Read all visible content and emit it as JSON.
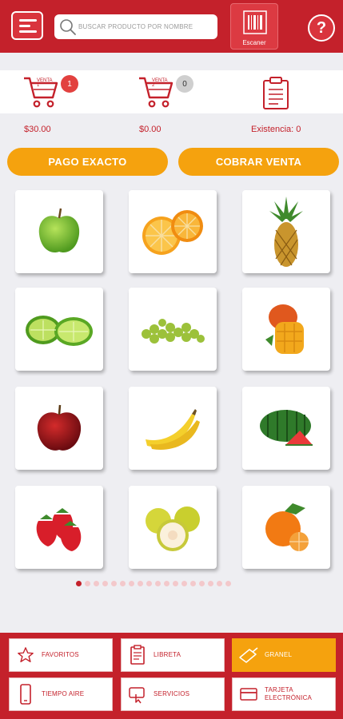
{
  "header": {
    "search_placeholder": "BUSCAR PRODUCTO POR NOMBRE",
    "scanner_label": "Escaner",
    "help_label": "?"
  },
  "sales": [
    {
      "label": "VENTA 1",
      "badge": "1",
      "amount": "$30.00"
    },
    {
      "label": "VENTA 2",
      "badge": "0",
      "amount": "$0.00"
    }
  ],
  "stock": {
    "label": "Existencia: 0"
  },
  "actions": {
    "exact_payment": "PAGO EXACTO",
    "charge_sale": "COBRAR VENTA"
  },
  "products": [
    {
      "name": "green-apple"
    },
    {
      "name": "orange"
    },
    {
      "name": "pineapple"
    },
    {
      "name": "lime"
    },
    {
      "name": "grapes"
    },
    {
      "name": "mango"
    },
    {
      "name": "red-apple"
    },
    {
      "name": "banana"
    },
    {
      "name": "watermelon"
    },
    {
      "name": "strawberry"
    },
    {
      "name": "guava"
    },
    {
      "name": "mandarin"
    }
  ],
  "pagination": {
    "total": 18,
    "current": 1
  },
  "bottom_nav": [
    {
      "label": "FAVORITOS",
      "icon": "star-icon"
    },
    {
      "label": "LIBRETA",
      "icon": "notebook-icon"
    },
    {
      "label": "GRANEL",
      "icon": "scoop-icon",
      "active": true
    },
    {
      "label": "TIEMPO AIRE",
      "icon": "phone-icon"
    },
    {
      "label": "SERVICIOS",
      "icon": "services-icon"
    },
    {
      "label": "TARJETA\nELECTRÓNICA",
      "icon": "card-icon"
    }
  ],
  "colors": {
    "brand": "#c4212b",
    "accent": "#f5a20e"
  }
}
